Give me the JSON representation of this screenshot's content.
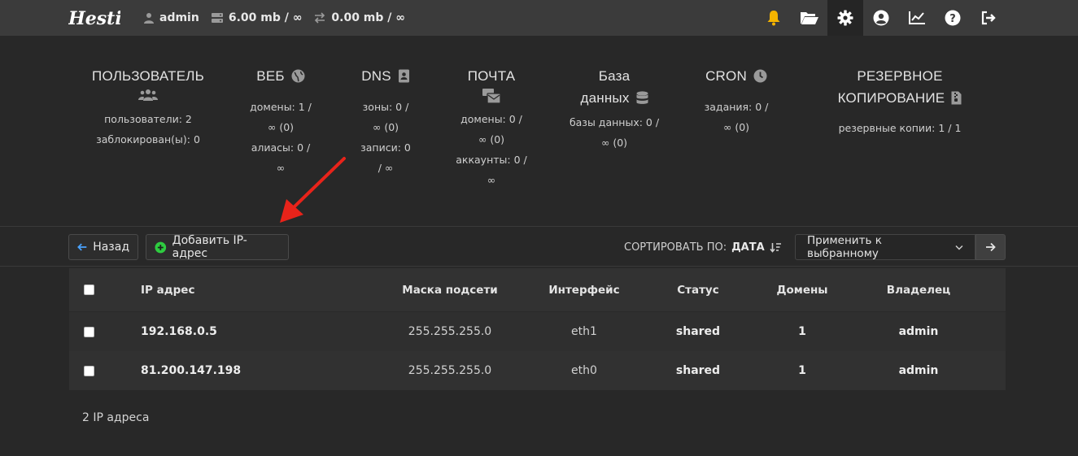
{
  "header": {
    "logo_text": "Hestia",
    "user": "admin",
    "disk": "6.00 mb / ∞",
    "bandwidth": "0.00 mb / ∞"
  },
  "stats": {
    "user": {
      "title": "ПОЛЬЗОВАТЕЛЬ",
      "lines": [
        "пользователи: 2",
        "заблокирован(ы): 0"
      ]
    },
    "web": {
      "title": "ВЕБ",
      "lines": [
        "домены: 1 /",
        "∞ (0)",
        "алиасы: 0 /",
        "∞"
      ]
    },
    "dns": {
      "title": "DNS",
      "lines": [
        "зоны: 0 /",
        "∞ (0)",
        "записи: 0",
        "/ ∞"
      ]
    },
    "mail": {
      "title": "ПОЧТА",
      "lines": [
        "домены: 0 /",
        "∞ (0)",
        "аккаунты: 0 /",
        "∞"
      ]
    },
    "db": {
      "title_line1": "База",
      "title_line2": "данных",
      "lines": [
        "базы данных: 0 /",
        "∞ (0)"
      ]
    },
    "cron": {
      "title": "CRON",
      "lines": [
        "задания: 0 /",
        "∞ (0)"
      ]
    },
    "backup": {
      "title_line1": "РЕЗЕРВНОЕ",
      "title_line2": "КОПИРОВАНИЕ",
      "lines": [
        "резервные копии: 1 / 1"
      ]
    }
  },
  "toolbar": {
    "back_label": "Назад",
    "add_label": "Добавить IP-адрес",
    "sort_label": "СОРТИРОВАТЬ ПО:",
    "sort_value": "ДАТА",
    "apply_select": "Применить к выбранному"
  },
  "table": {
    "headers": {
      "ip": "IP адрес",
      "mask": "Маска подсети",
      "iface": "Интерфейс",
      "status": "Статус",
      "domains": "Домены",
      "owner": "Владелец"
    },
    "rows": [
      {
        "ip": "192.168.0.5",
        "mask": "255.255.255.0",
        "iface": "eth1",
        "status": "shared",
        "domains": "1",
        "owner": "admin"
      },
      {
        "ip": "81.200.147.198",
        "mask": "255.255.255.0",
        "iface": "eth0",
        "status": "shared",
        "domains": "1",
        "owner": "admin"
      }
    ]
  },
  "footer": {
    "count": "2 IP адреса"
  },
  "colors": {
    "bell": "#f5b400",
    "add_icon": "#2ecc40",
    "back_arrow": "#4aa3ff",
    "annotation_arrow": "#e8231a"
  }
}
